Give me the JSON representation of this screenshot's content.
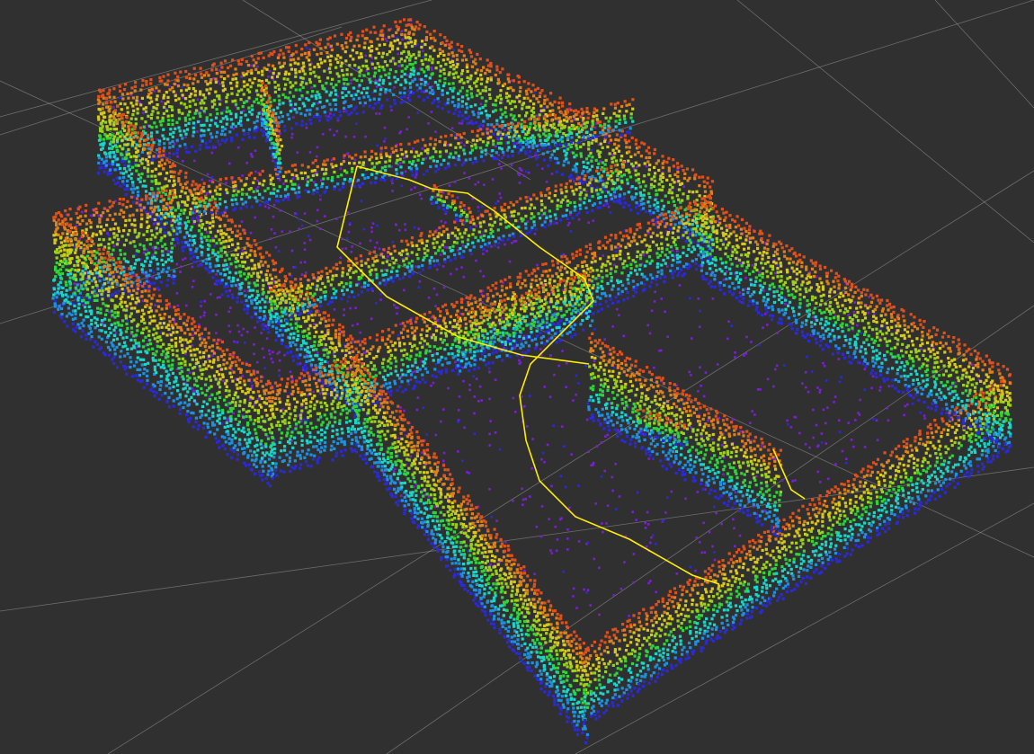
{
  "viewport": {
    "background_color": "#303030",
    "grid_color": "#a0a0a0",
    "trajectory_color": "#ffee00"
  },
  "point_cloud": {
    "colormap": "rainbow",
    "color_scale": [
      "#7a1fd6",
      "#2a2ad8",
      "#1f8fe0",
      "#19d6c8",
      "#2fd43a",
      "#9ad21a",
      "#d8c81a",
      "#e0801a",
      "#e0501a"
    ]
  }
}
